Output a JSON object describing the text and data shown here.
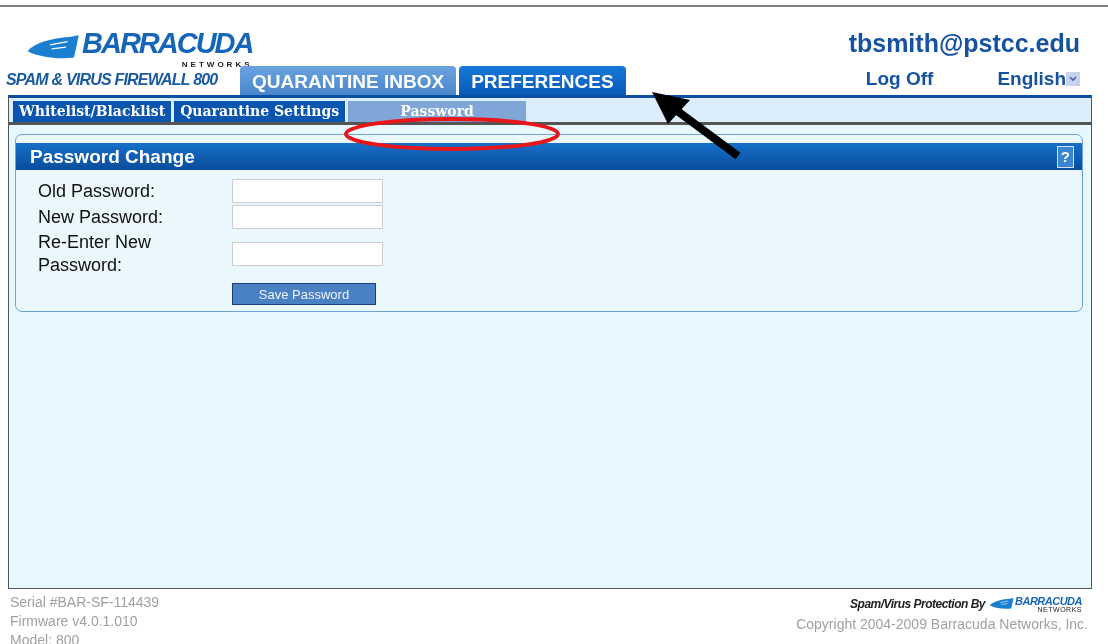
{
  "header": {
    "logo": {
      "name": "BARRACUDA",
      "tagline": "NETWORKS"
    },
    "product": "SPAM & VIRUS FIREWALL 800",
    "user": "tbsmith@pstcc.edu",
    "logoff": "Log Off",
    "language": "English"
  },
  "tabs": [
    {
      "label": "QUARANTINE INBOX",
      "selected": false
    },
    {
      "label": "PREFERENCES",
      "selected": true
    }
  ],
  "subtabs": [
    {
      "label": "Whitelist/Blacklist",
      "selected": false
    },
    {
      "label": "Quarantine Settings",
      "selected": false
    },
    {
      "label": "Password",
      "selected": true
    }
  ],
  "panel": {
    "title": "Password Change",
    "help": "?",
    "fields": [
      {
        "label": "Old Password:"
      },
      {
        "label": "New Password:"
      },
      {
        "label": "Re-Enter New Password:"
      }
    ],
    "button": "Save Password"
  },
  "footer": {
    "serial": "Serial #BAR-SF-114439",
    "firmware": "Firmware v4.0.1.010",
    "model": "Model: 800",
    "protection": "Spam/Virus Protection By",
    "logo": {
      "name": "BARRACUDA",
      "tagline": "NETWORKS"
    },
    "copyright": "Copyright 2004-2009 Barracuda Networks, Inc."
  }
}
